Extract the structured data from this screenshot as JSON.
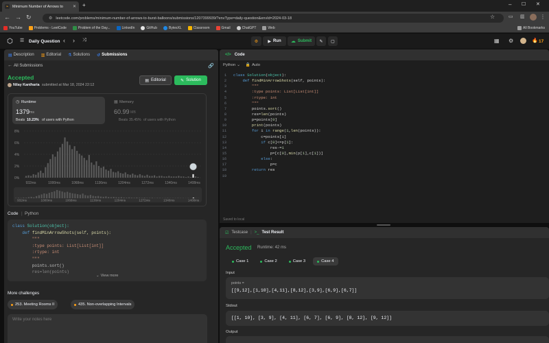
{
  "browser": {
    "tab_title": "Minimum Number of Arrows to",
    "url": "leetcode.com/problems/minimum-number-of-arrows-to-burst-balloons/submissions/1207399939/?envType=daily-question&envId=2024-03-18",
    "bookmarks": [
      "YouTube",
      "Problems - LeetCode",
      "Problem of the Day...",
      "LinkedIn",
      "GitHub",
      "BytesXL",
      "Classroom",
      "Gmail",
      "ChatGPT",
      "Web"
    ],
    "all_bookmarks": "All Bookmarks"
  },
  "header": {
    "daily_question": "Daily Question",
    "run": "Run",
    "submit": "Submit",
    "streak": "17"
  },
  "left": {
    "tabs": [
      "Description",
      "Editorial",
      "Solutions",
      "Submissions"
    ],
    "all_submissions": "All Submissions",
    "status": "Accepted",
    "author": "Nilay Kantharia",
    "submitted_text": "submitted at Mar 18, 2024 22:12",
    "editorial_btn": "Editorial",
    "solution_btn": "Solution",
    "runtime_label": "Runtime",
    "runtime_value": "1379",
    "runtime_unit": "ms",
    "runtime_beats_prefix": "Beats",
    "runtime_beats": "10.23%",
    "runtime_beats_suffix": "of users with Python",
    "memory_label": "Memory",
    "memory_value": "60.99",
    "memory_unit": "MB",
    "memory_beats_prefix": "Beats",
    "memory_beats": "35.45%",
    "memory_beats_suffix": "of users with Python",
    "code_label": "Code",
    "code_lang": "Python",
    "code_preview": [
      "class Solution(object):",
      "    def findMinArrowShots(self, points):",
      "        \"\"\"",
      "        :type points: List[List[int]]",
      "        :rtype: int",
      "        \"\"\"",
      "        points.sort()",
      "        res=len(points)"
    ],
    "view_more": "View more",
    "more_challenges": "More challenges",
    "challenges": [
      "253. Meeting Rooms II",
      "435. Non-overlapping Intervals"
    ],
    "notes_placeholder": "Write your notes here"
  },
  "chart_data": {
    "type": "bar",
    "y_ticks": [
      "8%",
      "6%",
      "4%",
      "2%",
      "0%"
    ],
    "x_ticks": [
      "932ms",
      "1000ms",
      "1068ms",
      "1136ms",
      "1204ms",
      "1272ms",
      "1340ms",
      "1408ms"
    ],
    "minimap_ticks": [
      "932ms",
      "1000ms",
      "1068ms",
      "1136ms",
      "1204ms",
      "1272ms",
      "1340ms",
      "1408ms"
    ],
    "ylim": [
      0,
      8
    ],
    "values": [
      0.3,
      0.4,
      0.3,
      0.6,
      0.5,
      0.9,
      1.2,
      0.8,
      1.8,
      2.5,
      3.2,
      4.0,
      3.6,
      4.5,
      5.2,
      5.8,
      6.9,
      6.2,
      5.6,
      4.9,
      5.4,
      4.6,
      4.1,
      3.8,
      3.4,
      3.0,
      3.9,
      2.6,
      2.2,
      2.8,
      2.0,
      1.7,
      1.9,
      1.4,
      1.2,
      1.5,
      1.0,
      0.9,
      1.1,
      0.8,
      0.7,
      0.9,
      0.6,
      0.5,
      0.7,
      0.5,
      0.4,
      0.6,
      0.4,
      0.3,
      0.5,
      0.3,
      0.3,
      0.4,
      0.2,
      0.3,
      0.3,
      0.2,
      0.2,
      0.3,
      0.2,
      0.2,
      0.2,
      0.3,
      0.2,
      0.2,
      0.1,
      0.2,
      0.1,
      0.6,
      0.2,
      0.1
    ],
    "highlight_index": 69
  },
  "editor": {
    "title": "Code",
    "lang": "Python",
    "auto": "Auto",
    "saved": "Saved to local",
    "lines": [
      {
        "t": [
          [
            "kw",
            "class "
          ],
          [
            "cls",
            "Solution"
          ],
          [
            "txt",
            "("
          ],
          [
            "cls",
            "object"
          ],
          [
            "txt",
            "):"
          ]
        ]
      },
      {
        "t": [
          [
            "txt",
            "    "
          ],
          [
            "kw",
            "def "
          ],
          [
            "fn",
            "findMinArrowShots"
          ],
          [
            "txt",
            "(self, points):"
          ]
        ]
      },
      {
        "t": [
          [
            "txt",
            "        "
          ],
          [
            "str",
            "\"\"\""
          ]
        ]
      },
      {
        "t": [
          [
            "txt",
            "        "
          ],
          [
            "str",
            ":type points: List[List[int]]"
          ]
        ]
      },
      {
        "t": [
          [
            "txt",
            "        "
          ],
          [
            "str",
            ":rtype: int"
          ]
        ]
      },
      {
        "t": [
          [
            "txt",
            "        "
          ],
          [
            "str",
            "\"\"\""
          ]
        ]
      },
      {
        "t": [
          [
            "txt",
            "        points."
          ],
          [
            "fn",
            "sort"
          ],
          [
            "txt",
            "()"
          ]
        ]
      },
      {
        "t": [
          [
            "txt",
            "        res="
          ],
          [
            "fn",
            "len"
          ],
          [
            "txt",
            "(points)"
          ]
        ]
      },
      {
        "t": [
          [
            "txt",
            "        p=points["
          ],
          [
            "num",
            "0"
          ],
          [
            "txt",
            "]"
          ]
        ]
      },
      {
        "t": [
          [
            "txt",
            "        "
          ],
          [
            "fn",
            "print"
          ],
          [
            "txt",
            "(points)"
          ]
        ]
      },
      {
        "t": [
          [
            "txt",
            "        "
          ],
          [
            "kw",
            "for "
          ],
          [
            "txt",
            "i "
          ],
          [
            "kw",
            "in "
          ],
          [
            "fn",
            "range"
          ],
          [
            "txt",
            "("
          ],
          [
            "num",
            "1"
          ],
          [
            "txt",
            ","
          ],
          [
            "fn",
            "len"
          ],
          [
            "txt",
            "(points)):"
          ]
        ]
      },
      {
        "t": [
          [
            "txt",
            "            c=points[i]"
          ]
        ]
      },
      {
        "t": [
          [
            "txt",
            "            "
          ],
          [
            "kw",
            "if "
          ],
          [
            "txt",
            "c["
          ],
          [
            "num",
            "0"
          ],
          [
            "txt",
            "]<=p["
          ],
          [
            "num",
            "1"
          ],
          [
            "txt",
            "]:"
          ]
        ]
      },
      {
        "t": [
          [
            "txt",
            "                res-="
          ],
          [
            "num",
            "1"
          ]
        ]
      },
      {
        "t": [
          [
            "txt",
            "                p=[c["
          ],
          [
            "num",
            "0"
          ],
          [
            "txt",
            "],"
          ],
          [
            "fn",
            "min"
          ],
          [
            "txt",
            "(p["
          ],
          [
            "num",
            "1"
          ],
          [
            "txt",
            "],c["
          ],
          [
            "num",
            "1"
          ],
          [
            "txt",
            "])]"
          ]
        ]
      },
      {
        "t": [
          [
            "txt",
            "            "
          ],
          [
            "kw",
            "else"
          ],
          [
            "txt",
            ":"
          ]
        ]
      },
      {
        "t": [
          [
            "txt",
            "                p=c"
          ]
        ]
      },
      {
        "t": [
          [
            "txt",
            "        "
          ],
          [
            "kw",
            "return "
          ],
          [
            "txt",
            "res"
          ]
        ]
      },
      {
        "t": [
          [
            "txt",
            ""
          ]
        ]
      }
    ]
  },
  "testpanel": {
    "tab_testcase": "Testcase",
    "tab_result": "Test Result",
    "status": "Accepted",
    "runtime": "Runtime: 42 ms",
    "cases": [
      "Case 1",
      "Case 2",
      "Case 3",
      "Case 4"
    ],
    "input_label": "Input",
    "points_label": "points =",
    "input_value": "[[9,12],[1,10],[4,11],[8,12],[3,9],[6,9],[6,7]]",
    "stdout_label": "Stdout",
    "stdout_value": "[[1, 10], [3, 9], [4, 11], [6, 7], [6, 9], [8, 12], [9, 12]]",
    "output_label": "Output"
  },
  "colors": {
    "accent": "#2cbb5d",
    "orange": "#ffa116",
    "bg": "#1a1a1a",
    "panel": "#262626"
  }
}
